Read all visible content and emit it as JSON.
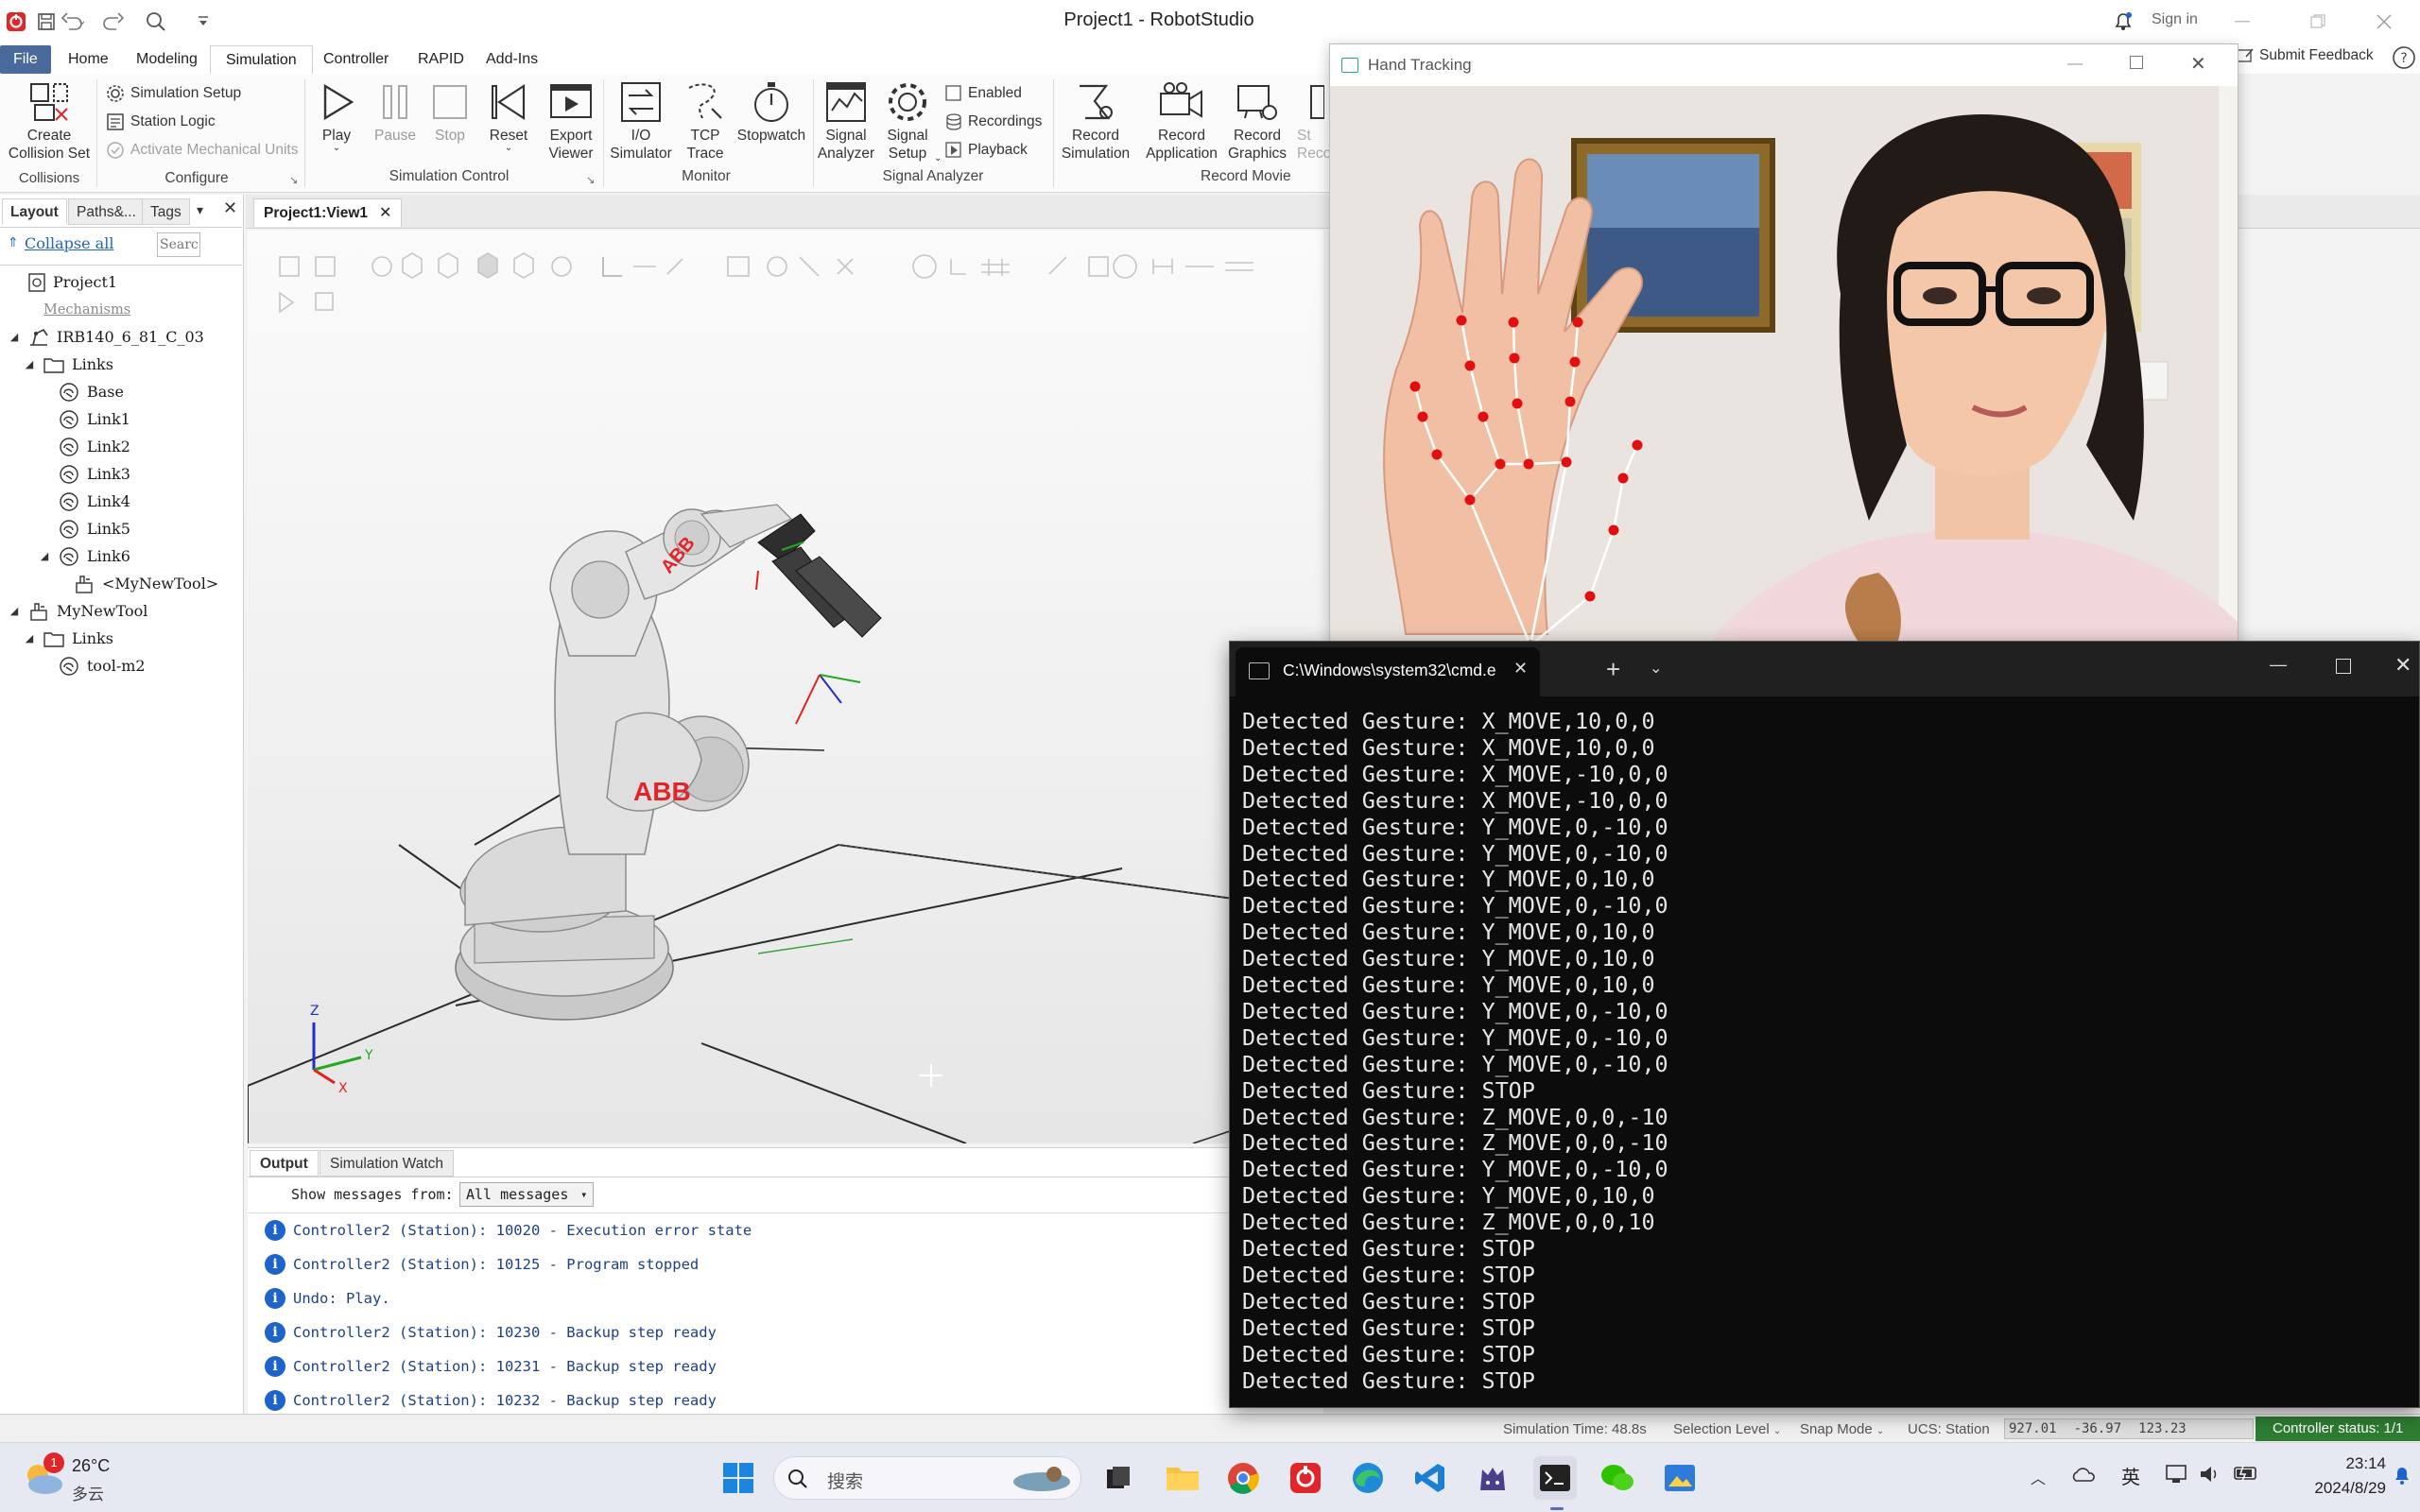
{
  "app": {
    "title": "Project1 - RobotStudio",
    "sign_in": "Sign in",
    "submit_feedback": "Submit Feedback"
  },
  "menu": {
    "tabs": [
      "File",
      "Home",
      "Modeling",
      "Simulation",
      "Controller",
      "RAPID",
      "Add-Ins"
    ],
    "active": "Simulation"
  },
  "ribbon": {
    "collisions": {
      "btn": "Create\nCollision Set",
      "group": "Collisions"
    },
    "configure": {
      "simulation_setup": "Simulation Setup",
      "station_logic": "Station Logic",
      "activate_mech": "Activate Mechanical Units",
      "group": "Configure"
    },
    "sim_control": {
      "play": "Play",
      "pause": "Pause",
      "stop": "Stop",
      "reset": "Reset",
      "export_viewer": "Export\nViewer",
      "group": "Simulation Control"
    },
    "monitor": {
      "io_sim": "I/O\nSimulator",
      "tcp_trace": "TCP\nTrace",
      "stopwatch": "Stopwatch",
      "group": "Monitor"
    },
    "signal_analyzer": {
      "signal_analyzer": "Signal\nAnalyzer",
      "signal_setup": "Signal\nSetup",
      "enabled": "Enabled",
      "recordings": "Recordings",
      "playback": "Playback",
      "group": "Signal Analyzer"
    },
    "record_movie": {
      "record_sim": "Record\nSimulation",
      "record_app": "Record\nApplication",
      "record_graphics": "Record\nGraphics",
      "st": "St",
      "reco": "Reco",
      "group": "Record Movie"
    }
  },
  "left_panel": {
    "tabs": [
      "Layout",
      "Paths&...",
      "Tags"
    ],
    "collapse_all": "Collapse all",
    "search_placeholder": "Search",
    "tree": [
      {
        "label": "Project1",
        "indent": 0,
        "toggle": "",
        "icon": "station-icon"
      },
      {
        "label": "Mechanisms",
        "indent": 1,
        "toggle": "",
        "icon": "",
        "muted": true
      },
      {
        "label": "IRB140_6_81_C_03",
        "indent": 0,
        "toggle": "◢",
        "icon": "robot-icon"
      },
      {
        "label": "Links",
        "indent": 1,
        "toggle": "◢",
        "icon": "folder-icon"
      },
      {
        "label": "Base",
        "indent": 2,
        "toggle": "",
        "icon": "link-icon"
      },
      {
        "label": "Link1",
        "indent": 2,
        "toggle": "",
        "icon": "link-icon"
      },
      {
        "label": "Link2",
        "indent": 2,
        "toggle": "",
        "icon": "link-icon"
      },
      {
        "label": "Link3",
        "indent": 2,
        "toggle": "",
        "icon": "link-icon"
      },
      {
        "label": "Link4",
        "indent": 2,
        "toggle": "",
        "icon": "link-icon"
      },
      {
        "label": "Link5",
        "indent": 2,
        "toggle": "",
        "icon": "link-icon"
      },
      {
        "label": "Link6",
        "indent": 2,
        "toggle": "◢",
        "icon": "link-icon"
      },
      {
        "label": "<MyNewTool>",
        "indent": 3,
        "toggle": "",
        "icon": "tool-icon"
      },
      {
        "label": "MyNewTool",
        "indent": 0,
        "toggle": "◢",
        "icon": "tool-icon"
      },
      {
        "label": "Links",
        "indent": 1,
        "toggle": "◢",
        "icon": "folder-icon"
      },
      {
        "label": "tool-m2",
        "indent": 2,
        "toggle": "",
        "icon": "link-icon"
      }
    ]
  },
  "view": {
    "tab": "Project1:View1",
    "robot_logo": "ABB",
    "axis_x": "X",
    "axis_y": "Y",
    "axis_z": "Z"
  },
  "output": {
    "tabs": [
      "Output",
      "Simulation Watch"
    ],
    "filter_label": "Show messages from:",
    "filter_value": "All messages",
    "messages": [
      "Controller2 (Station): 10020 - Execution error state",
      "Controller2 (Station): 10125 - Program stopped",
      "Undo: Play.",
      "Controller2 (Station): 10230 - Backup step ready",
      "Controller2 (Station): 10231 - Backup step ready",
      "Controller2 (Station): 10232 - Backup step ready"
    ]
  },
  "status": {
    "sim_time": "Simulation Time: 48.8s",
    "selection_level": "Selection Level",
    "snap_mode": "Snap Mode",
    "ucs": "UCS: Station",
    "x": "927.01",
    "y": "-36.97",
    "z": "123.23",
    "controller_status": "Controller status: 1/1"
  },
  "hand_window": {
    "title": "Hand Tracking"
  },
  "cmd_window": {
    "tab_title": "C:\\Windows\\system32\\cmd.e",
    "lines": [
      "Detected Gesture: X_MOVE,10,0,0",
      "Detected Gesture: X_MOVE,10,0,0",
      "Detected Gesture: X_MOVE,-10,0,0",
      "Detected Gesture: X_MOVE,-10,0,0",
      "Detected Gesture: Y_MOVE,0,-10,0",
      "Detected Gesture: Y_MOVE,0,-10,0",
      "Detected Gesture: Y_MOVE,0,10,0",
      "Detected Gesture: Y_MOVE,0,-10,0",
      "Detected Gesture: Y_MOVE,0,10,0",
      "Detected Gesture: Y_MOVE,0,10,0",
      "Detected Gesture: Y_MOVE,0,10,0",
      "Detected Gesture: Y_MOVE,0,-10,0",
      "Detected Gesture: Y_MOVE,0,-10,0",
      "Detected Gesture: Y_MOVE,0,-10,0",
      "Detected Gesture: STOP",
      "Detected Gesture: Z_MOVE,0,0,-10",
      "Detected Gesture: Z_MOVE,0,0,-10",
      "Detected Gesture: Y_MOVE,0,-10,0",
      "Detected Gesture: Y_MOVE,0,10,0",
      "Detected Gesture: Z_MOVE,0,0,10",
      "Detected Gesture: STOP",
      "Detected Gesture: STOP",
      "Detected Gesture: STOP",
      "Detected Gesture: STOP",
      "Detected Gesture: STOP",
      "Detected Gesture: STOP"
    ]
  },
  "taskbar": {
    "weather_temp": "26°C",
    "weather_desc": "多云",
    "weather_badge": "1",
    "search_placeholder": "搜索",
    "ime": "英",
    "time": "23:14",
    "date": "2024/8/29"
  },
  "colors": {
    "accent": "#1e63c9",
    "file_tab": "#4a6a9c",
    "controller_status_bg": "#2e7d32",
    "cmd_bg": "#0c0c0c",
    "landmark": "#e01010"
  }
}
